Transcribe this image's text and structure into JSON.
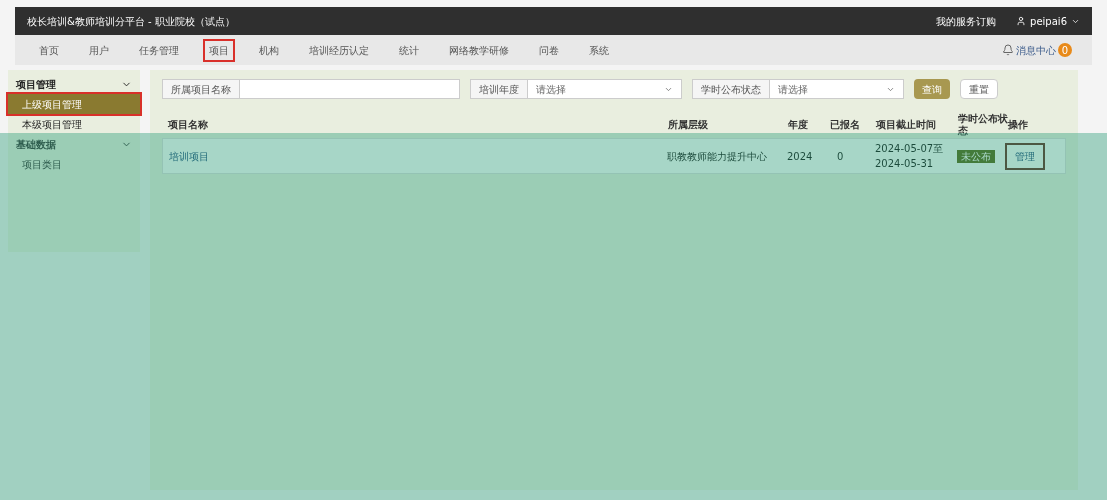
{
  "header": {
    "title": "校长培训&教师培训分平台 - 职业院校（试点）",
    "links": [
      {
        "kind": "text",
        "label": "我的服务订购"
      },
      {
        "kind": "user",
        "label": "peipai6"
      }
    ]
  },
  "nav": {
    "items": [
      {
        "label": "首页",
        "highlighted": false
      },
      {
        "label": "用户",
        "highlighted": false
      },
      {
        "label": "任务管理",
        "highlighted": false
      },
      {
        "label": "项目",
        "highlighted": true
      },
      {
        "label": "机构",
        "highlighted": false
      },
      {
        "label": "培训经历认定",
        "highlighted": false
      },
      {
        "label": "统计",
        "highlighted": false
      },
      {
        "label": "网络教学研修",
        "highlighted": false
      },
      {
        "label": "问卷",
        "highlighted": false
      },
      {
        "label": "系统",
        "highlighted": false
      }
    ],
    "messages": {
      "label": "消息中心",
      "count": "0"
    }
  },
  "sidebar": {
    "groups": [
      {
        "label": "项目管理",
        "expanded": true,
        "children": [
          {
            "label": "上级项目管理",
            "selected": true,
            "highlighted": true
          },
          {
            "label": "本级项目管理",
            "selected": false,
            "highlighted": false
          }
        ]
      },
      {
        "label": "基础数据",
        "expanded": true,
        "children": [
          {
            "label": "项目类目",
            "selected": false,
            "highlighted": false
          }
        ]
      }
    ]
  },
  "filters": [
    {
      "kind": "text",
      "label": "所属项目名称"
    },
    {
      "kind": "select",
      "label": "培训年度",
      "value": "请选择"
    },
    {
      "kind": "select",
      "label": "学时公布状态",
      "value": "请选择"
    }
  ],
  "buttons": [
    {
      "kind": "primary",
      "label": "查询"
    },
    {
      "kind": "default",
      "label": "重置"
    }
  ],
  "table": {
    "columns": [
      "项目名称",
      "所属层级",
      "年度",
      "已报名",
      "项目截止时间",
      "学时公布状态",
      "操作"
    ],
    "rows": [
      {
        "name": "培训项目",
        "level": "职教教师能力提升中心",
        "year": "2024",
        "enrolled": "0",
        "deadline": [
          "2024-05-07至",
          "2024-05-31"
        ],
        "status": "未公布",
        "action": {
          "label": "管理",
          "highlighted": true
        }
      }
    ]
  }
}
